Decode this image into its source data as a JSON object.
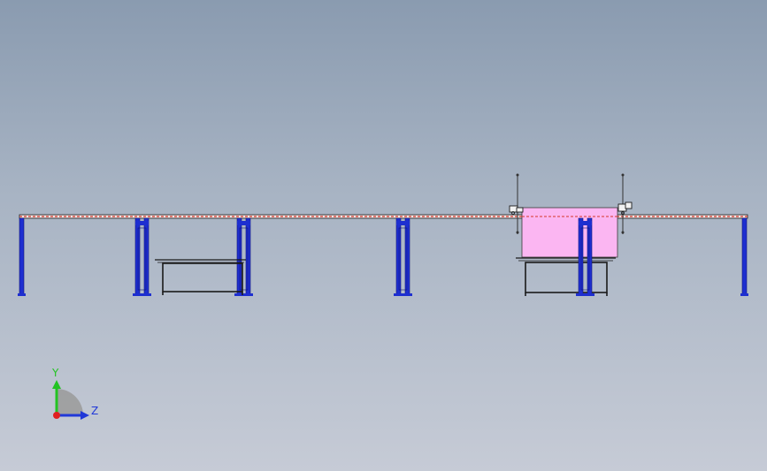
{
  "triad": {
    "y_label": "Y",
    "z_label": "Z"
  },
  "colors": {
    "frame": "#1e2fd0",
    "rail": "#d4372a",
    "panel": "#fbb6f2",
    "line": "#1a1a1a",
    "y_axis": "#22c322",
    "z_axis": "#2038d8",
    "origin": "#e02020"
  }
}
